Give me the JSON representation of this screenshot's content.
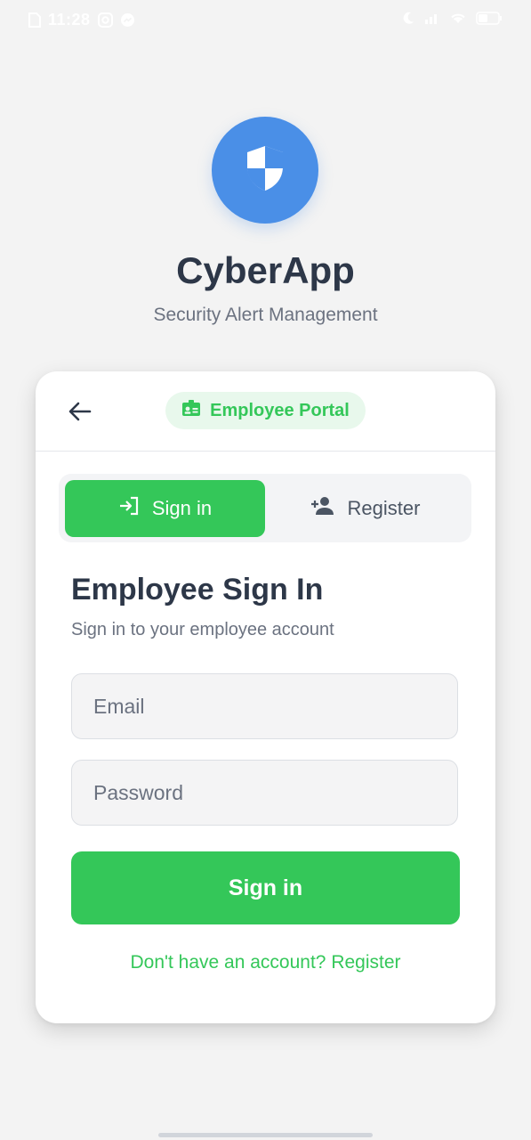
{
  "status_bar": {
    "time": "11:28",
    "icons_left": [
      "file-icon",
      "instagram-icon",
      "messenger-icon"
    ],
    "icons_right": [
      "moon-icon",
      "signal-icon",
      "wifi-icon",
      "battery-icon"
    ]
  },
  "header": {
    "logo_icon": "shield-icon",
    "title": "CyberApp",
    "subtitle": "Security Alert Management"
  },
  "card": {
    "back_icon": "arrow-left-icon",
    "portal_icon": "id-badge-icon",
    "portal_label": "Employee Portal",
    "tabs": [
      {
        "label": "Sign in",
        "icon": "login-icon",
        "active": true
      },
      {
        "label": "Register",
        "icon": "person-add-icon",
        "active": false
      }
    ],
    "form": {
      "title": "Employee Sign In",
      "subtitle": "Sign in to your employee account",
      "email_placeholder": "Email",
      "email_value": "",
      "password_placeholder": "Password",
      "password_value": "",
      "submit_label": "Sign in",
      "register_link": "Don't have an account? Register"
    }
  },
  "colors": {
    "background": "#f3f3f3",
    "primary_green": "#34c759",
    "logo_blue": "#4a8fe7",
    "text_dark": "#2d3748",
    "text_muted": "#6b7280"
  }
}
